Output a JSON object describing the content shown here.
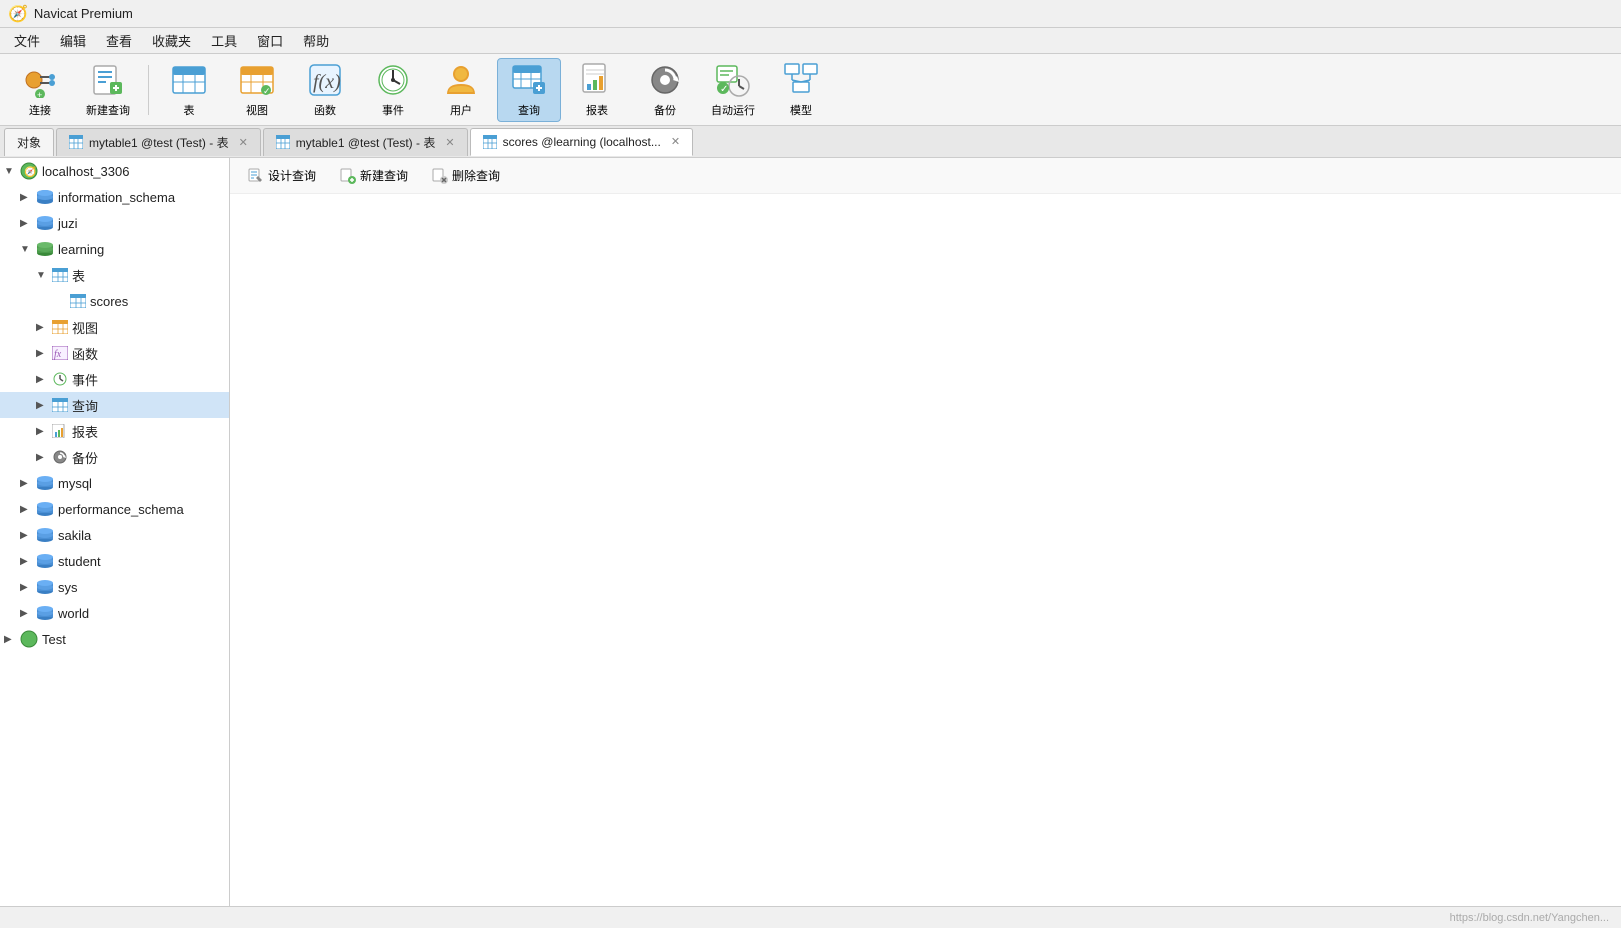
{
  "app": {
    "title": "Navicat Premium",
    "logo": "🧭"
  },
  "menu": {
    "items": [
      "文件",
      "编辑",
      "查看",
      "收藏夹",
      "工具",
      "窗口",
      "帮助"
    ]
  },
  "toolbar": {
    "buttons": [
      {
        "id": "connect",
        "label": "连接",
        "icon": "connect"
      },
      {
        "id": "new-query",
        "label": "新建查询",
        "icon": "new-query"
      },
      {
        "separator": true
      },
      {
        "id": "table",
        "label": "表",
        "icon": "table"
      },
      {
        "id": "view",
        "label": "视图",
        "icon": "view"
      },
      {
        "id": "function",
        "label": "函数",
        "icon": "function"
      },
      {
        "id": "event",
        "label": "事件",
        "icon": "event"
      },
      {
        "id": "user",
        "label": "用户",
        "icon": "user"
      },
      {
        "id": "query",
        "label": "查询",
        "icon": "query",
        "active": true
      },
      {
        "id": "report",
        "label": "报表",
        "icon": "report"
      },
      {
        "id": "backup",
        "label": "备份",
        "icon": "backup"
      },
      {
        "id": "auto-run",
        "label": "自动运行",
        "icon": "auto-run"
      },
      {
        "id": "model",
        "label": "模型",
        "icon": "model"
      }
    ]
  },
  "tabs": {
    "static_tab": "对象",
    "items": [
      {
        "id": "tab1",
        "label": "mytable1 @test (Test) - 表",
        "icon": "table",
        "active": false
      },
      {
        "id": "tab2",
        "label": "mytable1 @test (Test) - 表",
        "icon": "table",
        "active": false
      },
      {
        "id": "tab3",
        "label": "scores @learning (localhost...",
        "icon": "table",
        "active": true
      }
    ]
  },
  "object_toolbar": {
    "buttons": [
      {
        "id": "design-query",
        "label": "设计查询",
        "icon": "design"
      },
      {
        "id": "new-query",
        "label": "新建查询",
        "icon": "new"
      },
      {
        "id": "delete-query",
        "label": "删除查询",
        "icon": "delete"
      }
    ]
  },
  "sidebar": {
    "connection": {
      "label": "localhost_3306",
      "expanded": true,
      "icon": "connection"
    },
    "databases": [
      {
        "id": "information_schema",
        "label": "information_schema",
        "icon": "db",
        "expanded": false
      },
      {
        "id": "juzi",
        "label": "juzi",
        "icon": "db",
        "expanded": false
      },
      {
        "id": "learning",
        "label": "learning",
        "icon": "db-green",
        "expanded": true,
        "children": [
          {
            "id": "tables-group",
            "label": "表",
            "icon": "table-group",
            "expanded": true,
            "children": [
              {
                "id": "scores",
                "label": "scores",
                "icon": "table"
              }
            ]
          },
          {
            "id": "views-group",
            "label": "视图",
            "icon": "view-group",
            "expanded": false
          },
          {
            "id": "functions-group",
            "label": "函数",
            "icon": "func-group",
            "expanded": false
          },
          {
            "id": "events-group",
            "label": "事件",
            "icon": "event-group",
            "expanded": false
          },
          {
            "id": "queries-group",
            "label": "查询",
            "icon": "query-group",
            "expanded": false,
            "selected": true
          },
          {
            "id": "reports-group",
            "label": "报表",
            "icon": "report-group",
            "expanded": false
          },
          {
            "id": "backup-group",
            "label": "备份",
            "icon": "backup-group",
            "expanded": false
          }
        ]
      },
      {
        "id": "mysql",
        "label": "mysql",
        "icon": "db",
        "expanded": false
      },
      {
        "id": "performance_schema",
        "label": "performance_schema",
        "icon": "db",
        "expanded": false
      },
      {
        "id": "sakila",
        "label": "sakila",
        "icon": "db",
        "expanded": false
      },
      {
        "id": "student",
        "label": "student",
        "icon": "db",
        "expanded": false
      },
      {
        "id": "sys",
        "label": "sys",
        "icon": "db",
        "expanded": false
      },
      {
        "id": "world",
        "label": "world",
        "icon": "db",
        "expanded": false
      }
    ],
    "second_connection": {
      "label": "Test",
      "icon": "connection",
      "expanded": false
    }
  },
  "footer": {
    "url": "https://blog.csdn.net/Yangchen..."
  }
}
